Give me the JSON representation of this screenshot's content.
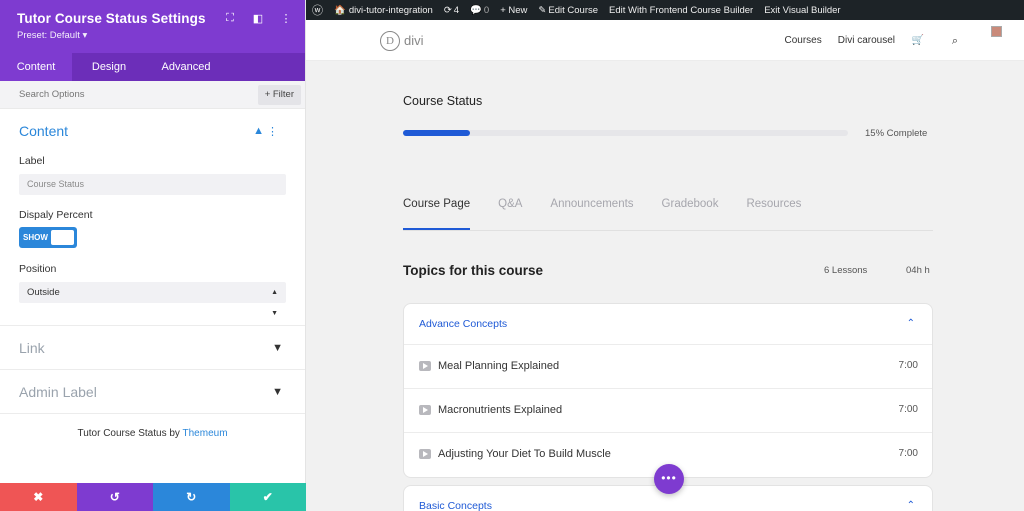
{
  "panel": {
    "title": "Tutor Course Status Settings",
    "preset": "Preset: Default ▾",
    "icons": [
      "expand-icon",
      "sidebar-icon",
      "more-icon"
    ],
    "tabs": [
      {
        "label": "Content"
      },
      {
        "label": "Design"
      },
      {
        "label": "Advanced"
      }
    ],
    "search_placeholder": "Search Options",
    "filter_label": "+ Filter",
    "content_section": {
      "title": "Content",
      "label_field": {
        "label": "Label",
        "value": "Course Status"
      },
      "display_percent": {
        "label": "Dispaly Percent",
        "toggle_text": "SHOW",
        "on": true
      },
      "position": {
        "label": "Position",
        "value": "Outside"
      }
    },
    "collapsed_sections": [
      {
        "title": "Link"
      },
      {
        "title": "Admin Label"
      }
    ],
    "credit_prefix": "Tutor Course Status by",
    "credit_link": "Themeum",
    "footer_buttons": [
      {
        "icon": "close-icon",
        "glyph": "✖",
        "color": "#ef5555"
      },
      {
        "icon": "undo-icon",
        "glyph": "↺",
        "color": "#7e3bd0"
      },
      {
        "icon": "redo-icon",
        "glyph": "↻",
        "color": "#2b87da"
      },
      {
        "icon": "check-icon",
        "glyph": "✔",
        "color": "#29c4a9"
      }
    ]
  },
  "wp_bar": {
    "items": [
      "divi-tutor-integration",
      "4",
      "0",
      "+ New",
      "Edit Course",
      "Edit With Frontend Course Builder",
      "Exit Visual Builder"
    ]
  },
  "site": {
    "logo": "divi",
    "nav": [
      "Courses",
      "Divi carousel"
    ]
  },
  "course": {
    "status_title": "Course Status",
    "progress_percent": 15,
    "progress_text": "15% Complete",
    "tabs": [
      "Course Page",
      "Q&A",
      "Announcements",
      "Gradebook",
      "Resources"
    ],
    "topics_title": "Topics for this course",
    "lessons_count": "6 Lessons",
    "duration": "04h h",
    "topic1": {
      "title": "Advance Concepts",
      "lessons": [
        {
          "name": "Meal Planning Explained",
          "time": "7:00"
        },
        {
          "name": "Macronutrients Explained",
          "time": "7:00"
        },
        {
          "name": "Adjusting Your Diet To Build Muscle",
          "time": "7:00"
        }
      ]
    },
    "topic2": {
      "title": "Basic Concepts"
    },
    "fab_label": "•••"
  },
  "colors": {
    "accent": "#7e3bd0",
    "link": "#2b87da",
    "progress": "#1f5ad6"
  }
}
